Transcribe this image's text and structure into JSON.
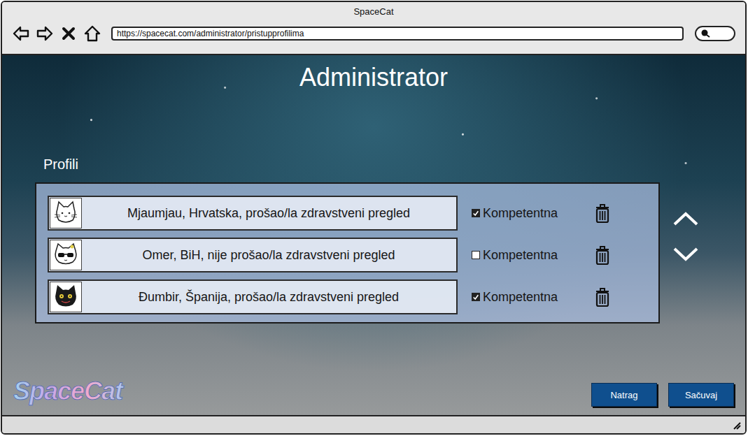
{
  "window": {
    "title": "SpaceCat"
  },
  "address_bar": {
    "url": "https://spacecat.com/administrator/pristupprofilima"
  },
  "page": {
    "title": "Administrator",
    "section": "Profili"
  },
  "profiles": [
    {
      "text": "Mjaumjau, Hrvatska, prošao/la zdravstveni pregled",
      "label": "Kompetentna",
      "checked": true
    },
    {
      "text": "Omer, BiH, nije prošao/la zdravstveni pregled",
      "label": "Kompetentna",
      "checked": false
    },
    {
      "text": "Đumbir, Španija, prošao/la zdravstveni pregled",
      "label": "Kompetentna",
      "checked": true
    }
  ],
  "logo": "SpaceCat",
  "buttons": [
    "Natrag",
    "Sačuvaj"
  ]
}
